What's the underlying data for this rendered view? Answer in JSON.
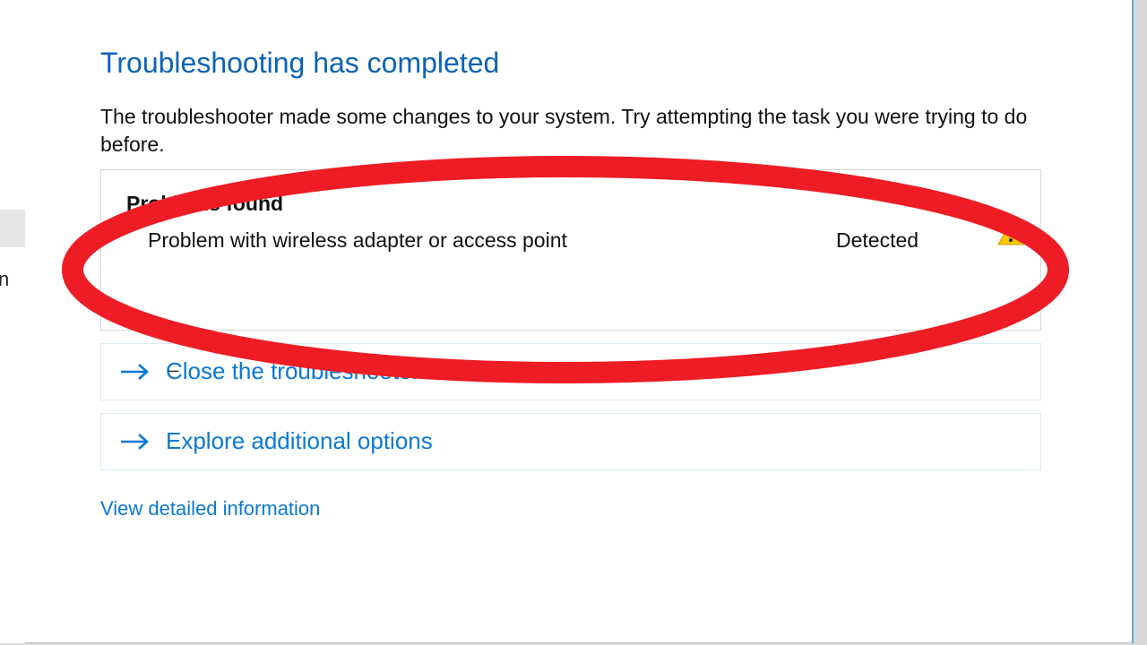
{
  "colors": {
    "accent": "#0a78d6",
    "title": "#0a63b8",
    "annotation": "#ee1c25"
  },
  "sidebar": {
    "fragment": "n"
  },
  "header": {
    "title": "Troubleshooting has completed",
    "subtitle": "The troubleshooter made some changes to your system. Try attempting the task you were trying to do before."
  },
  "problems": {
    "heading": "Problems found",
    "items": [
      {
        "description": "Problem with wireless adapter or access point",
        "status": "Detected",
        "icon": "warning-icon"
      }
    ]
  },
  "options": [
    {
      "id": "close",
      "label": "Close the troubleshooter"
    },
    {
      "id": "explore",
      "label": "Explore additional options"
    }
  ],
  "links": {
    "detailed": "View detailed information"
  }
}
